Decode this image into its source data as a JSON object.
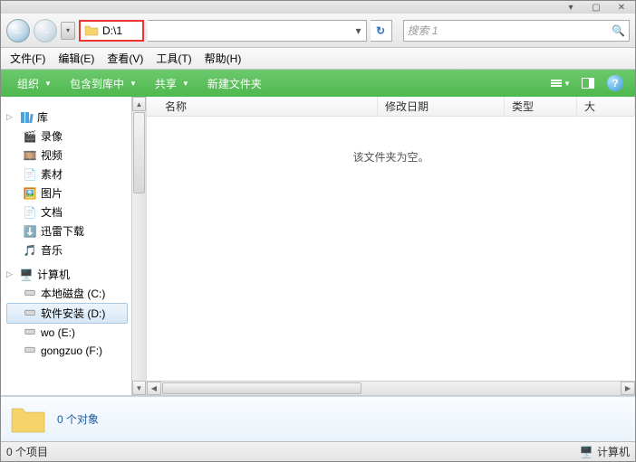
{
  "titlebar": {
    "min": "▾",
    "max": "▢",
    "close": "✕"
  },
  "nav": {
    "back": "←",
    "fwd": "→",
    "hist": "▾"
  },
  "address": {
    "path": "D:\\1",
    "dropdown": "▾",
    "refresh": "↻"
  },
  "search": {
    "placeholder": "搜索 1"
  },
  "menubar": {
    "file": "文件(F)",
    "edit": "编辑(E)",
    "view": "查看(V)",
    "tools": "工具(T)",
    "help": "帮助(H)"
  },
  "toolbar": {
    "organize": "组织",
    "include": "包含到库中",
    "share": "共享",
    "newfolder": "新建文件夹",
    "help": "?"
  },
  "columns": {
    "name": "名称",
    "date": "修改日期",
    "type": "类型",
    "size": "大"
  },
  "content": {
    "empty": "该文件夹为空。"
  },
  "tree": {
    "libs_label": "库",
    "libs": [
      "录像",
      "视频",
      "素材",
      "图片",
      "文档",
      "迅雷下载",
      "音乐"
    ],
    "computer_label": "计算机",
    "drives": [
      {
        "label": "本地磁盘 (C:)"
      },
      {
        "label": "软件安装 (D:)",
        "selected": true
      },
      {
        "label": "wo (E:)"
      },
      {
        "label": "gongzuo (F:)"
      }
    ]
  },
  "details": {
    "text": "0 个对象"
  },
  "status": {
    "left": "0 个项目",
    "right": "计算机"
  }
}
